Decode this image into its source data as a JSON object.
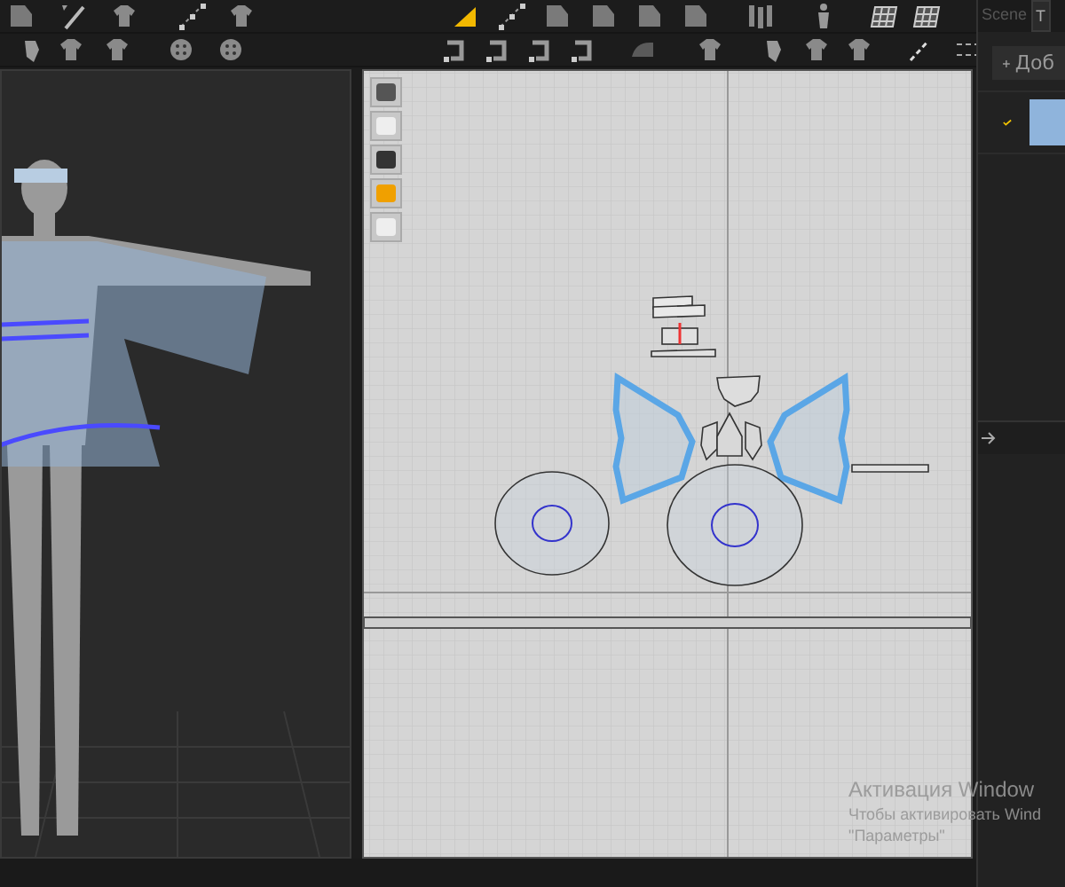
{
  "right_panel": {
    "tabs": [
      {
        "label": "Scene",
        "selected": false
      },
      {
        "label": "T",
        "selected": true
      }
    ],
    "add_button": {
      "label": "Доб"
    },
    "items": [
      {
        "checked": true
      }
    ]
  },
  "activation_notice": {
    "title": "Активация Window",
    "text": "Чтобы активировать Wind",
    "hint": "\"Параметры\""
  }
}
